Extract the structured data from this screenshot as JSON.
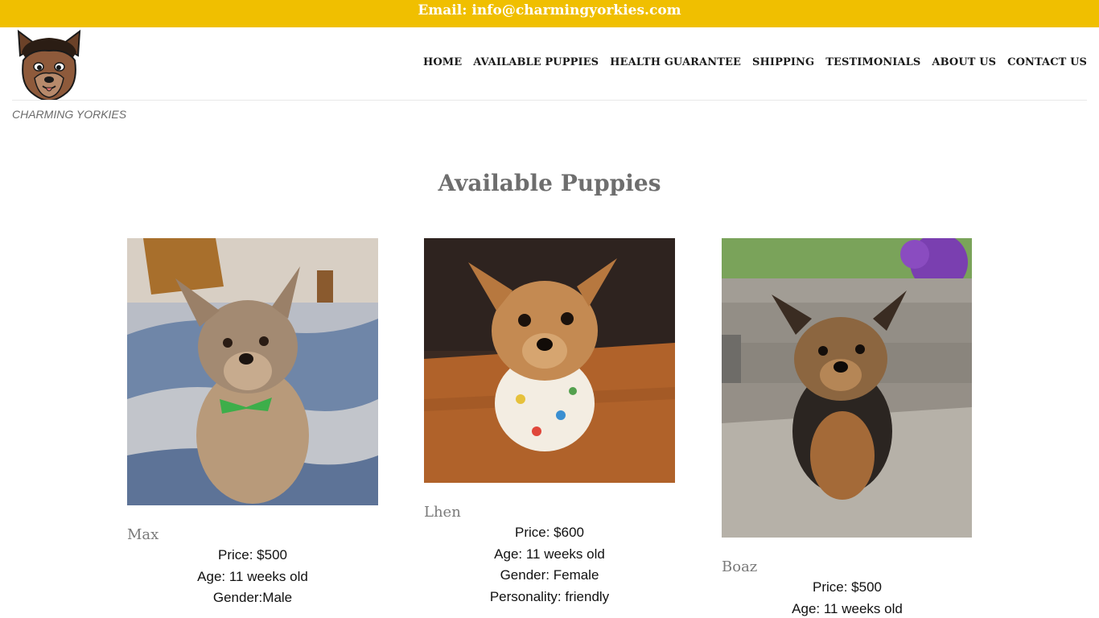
{
  "topbar": {
    "email_text": "Email: info@charmingyorkies.com"
  },
  "header": {
    "logo_icon": "yorkie-face-logo",
    "nav": [
      {
        "label": "HOME"
      },
      {
        "label": "AVAILABLE PUPPIES"
      },
      {
        "label": "HEALTH GUARANTEE"
      },
      {
        "label": "SHIPPING"
      },
      {
        "label": "TESTIMONIALS"
      },
      {
        "label": "ABOUT US"
      },
      {
        "label": "CONTACT US"
      }
    ]
  },
  "site_name": "CHARMING YORKIES",
  "main": {
    "title": "Available Puppies",
    "puppies": [
      {
        "name": "Max",
        "price": "Price: $500",
        "age": "Age: 11 weeks old",
        "gender": "Gender:Male",
        "personality": ""
      },
      {
        "name": "Lhen",
        "price": "Price: $600",
        "age": "Age: 11 weeks old",
        "gender": "Gender: Female",
        "personality": "Personality: friendly"
      },
      {
        "name": "Boaz",
        "price": "Price: $500",
        "age": "Age: 11 weeks old",
        "gender": "",
        "personality": ""
      }
    ]
  },
  "colors": {
    "topbar": "#f0bf00",
    "title": "#6e6e6e",
    "nav": "#1b1b1b"
  }
}
